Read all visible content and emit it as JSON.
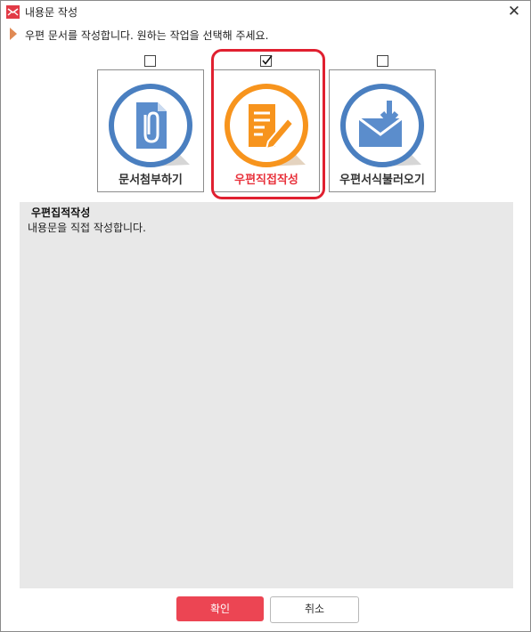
{
  "window": {
    "title": "내용문 작성",
    "close_symbol": "✕"
  },
  "instruction": "우편 문서를 작성합니다. 원하는 작업을 선택해 주세요.",
  "options": [
    {
      "label": "문서첨부하기",
      "checked": false,
      "icon": "paperclip-document-icon",
      "color": "#4a7fc0"
    },
    {
      "label": "우편직접작성",
      "checked": true,
      "icon": "document-pencil-icon",
      "color": "#f7941d"
    },
    {
      "label": "우편서식불러오기",
      "checked": false,
      "icon": "envelope-arrow-icon",
      "color": "#4a7fc0"
    }
  ],
  "description": {
    "title": "우편집적작성",
    "text": "내용문을 직접 작성합니다."
  },
  "buttons": {
    "confirm": "확인",
    "cancel": "취소"
  },
  "colors": {
    "accent": "#ec4553",
    "selection": "#e02030",
    "active_label": "#e8323c"
  }
}
